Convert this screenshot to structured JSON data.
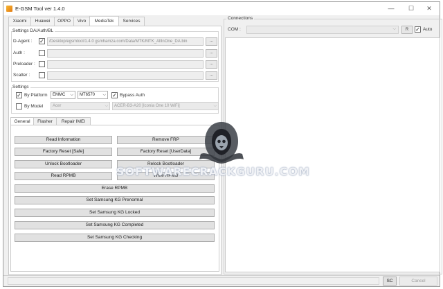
{
  "window": {
    "title": "E-GSM Tool ver 1.4.0"
  },
  "tabs": [
    "Xiaomi",
    "Huawei",
    "OPPO",
    "Vivo",
    "MediaTek",
    "Services"
  ],
  "active_tab": "MediaTek",
  "da_group": {
    "title": "Settings DA/Auth/BL",
    "rows": [
      {
        "label": "D-Agent :",
        "checked": true,
        "path": "/Desktop/egsmtool/1.4.0 gsmhamza.com/Data/MTK/MTK_AllInOne_DA.bin",
        "browse": "..."
      },
      {
        "label": "Auth :",
        "checked": false,
        "path": "",
        "browse": "..."
      },
      {
        "label": "Preloader :",
        "checked": false,
        "path": "",
        "browse": "..."
      },
      {
        "label": "Scatter :",
        "checked": false,
        "path": "",
        "browse": "..."
      }
    ]
  },
  "settings_group": {
    "title": "Settings",
    "by_platform_label": "By Platform",
    "by_platform_checked": true,
    "storage": "EMMC",
    "chip": "MT6570",
    "bypass_auth_label": "Bypass Auth",
    "bypass_auth_checked": true,
    "by_model_label": "By Model",
    "by_model_checked": false,
    "brand": "Acer",
    "model": "ACER-B3-A20 [Iconia One 10 WiFi]"
  },
  "subtabs": [
    "General",
    "Flasher",
    "Repair IMEI"
  ],
  "active_subtab": "General",
  "buttons": {
    "read_information": "Read Information",
    "remove_frp": "Remove FRP",
    "factory_reset_safe": "Factory Reset [Safe]",
    "factory_reset_userdata": "Factory Reset [UserData]",
    "unlock_bootloader": "Unlock Bootloader",
    "relock_bootloader": "Relock Bootloader",
    "read_rpmb": "Read RPMB",
    "write_rpmb": "Write RPMB",
    "erase_rpmb": "Erase RPMB",
    "kg_prenormal": "Set Samsung KG Prenormal",
    "kg_locked": "Set Samsung KG Locked",
    "kg_completed": "Set Samsung KG Completed",
    "kg_checking": "Set Samsung KG Checking"
  },
  "connections": {
    "title": "Connections",
    "com_label": "COM :",
    "com_value": "",
    "refresh_label": "R",
    "auto_label": "Auto",
    "auto_checked": true
  },
  "status_bar": {
    "sc_label": "SC",
    "cancel_label": "Cancel"
  },
  "watermark_text": "SOFTWARECRACKGURU.COM",
  "icons": {
    "app": "app-logo-icon",
    "minimize": "minimize-icon",
    "maximize": "maximize-icon",
    "close": "close-icon",
    "dropdown": "chevron-down-icon",
    "check": "checkmark-icon"
  }
}
